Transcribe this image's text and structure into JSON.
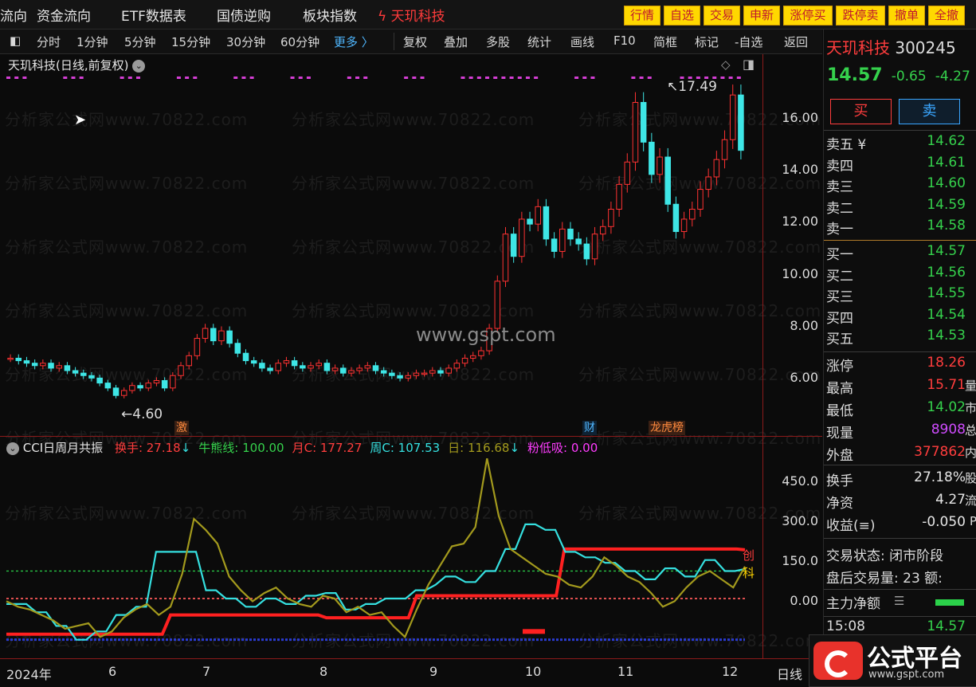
{
  "top_menu": {
    "items": [
      "流向",
      "资金流向",
      "ETF数据表",
      "国债逆购",
      "板块指数"
    ],
    "stock_name": "天玑科技",
    "trade_buttons": [
      "行情",
      "自选",
      "交易",
      "申新",
      "涨停买",
      "跌停卖",
      "撤单",
      "全撤"
    ]
  },
  "toolbar": {
    "periods": [
      "分时",
      "1分钟",
      "5分钟",
      "15分钟",
      "30分钟",
      "60分钟"
    ],
    "more": "更多 〉",
    "actions": [
      "复权",
      "叠加",
      "多股",
      "统计",
      "画线",
      "F10",
      "简框",
      "标记",
      "-自选",
      "返回"
    ]
  },
  "main_chart": {
    "title": "天玑科技(日线,前复权)",
    "high_label": "17.49",
    "low_label": "4.60",
    "tags": [
      {
        "text": "激",
        "color": "#ff8a3d"
      },
      {
        "text": "财",
        "color": "#4fb7ff"
      },
      {
        "text": "龙虎榜",
        "color": "#ff8a3d"
      }
    ],
    "watermark": "分析家公式网www.70822.com",
    "site_watermark": "www.gspt.com"
  },
  "price_axis": [
    "16.00",
    "14.00",
    "12.00",
    "10.00",
    "8.00",
    "6.00"
  ],
  "indicator": {
    "name": "CCI日周月共振",
    "fields": [
      {
        "label": "换手: 27.18",
        "color": "#ff3d3d",
        "arrow": "↓"
      },
      {
        "label": "牛熊线: 100.00",
        "color": "#35d14c",
        "arrow": ""
      },
      {
        "label": "月C: 177.27",
        "color": "#ff3d3d",
        "arrow": ""
      },
      {
        "label": "周C: 107.53",
        "color": "#35e0e0",
        "arrow": ""
      },
      {
        "label": "日: 116.68",
        "color": "#a39a1d",
        "arrow": "↓"
      },
      {
        "label": "粉低吸: 0.00",
        "color": "#ff3cff",
        "arrow": ""
      }
    ],
    "axis": [
      "450.0",
      "300.0",
      "150.0",
      "0.00"
    ],
    "right_labels": {
      "month": "创",
      "day": "科"
    }
  },
  "time_axis": {
    "labels": [
      "2024年",
      "6",
      "7",
      "8",
      "9",
      "10",
      "11",
      "12"
    ],
    "period": "日线"
  },
  "quote": {
    "name": "天玑科技",
    "code": "300245",
    "price": "14.57",
    "change": "-0.65",
    "pct": "-4.27",
    "buy": "买",
    "sell": "卖",
    "asks": [
      {
        "label": "卖五 ¥",
        "price": "14.62"
      },
      {
        "label": "卖四",
        "price": "14.61"
      },
      {
        "label": "卖三",
        "price": "14.60"
      },
      {
        "label": "卖二",
        "price": "14.59"
      },
      {
        "label": "卖一",
        "price": "14.58"
      }
    ],
    "bids": [
      {
        "label": "买一",
        "price": "14.57"
      },
      {
        "label": "买二",
        "price": "14.56"
      },
      {
        "label": "买三",
        "price": "14.55"
      },
      {
        "label": "买四",
        "price": "14.54"
      },
      {
        "label": "买五",
        "price": "14.53"
      }
    ],
    "stats1": [
      {
        "label": "涨停",
        "value": "18.26",
        "color": "#ff3d3d",
        "suffix": ""
      },
      {
        "label": "最高",
        "value": "15.71",
        "color": "#ff3d3d",
        "suffix": "量"
      },
      {
        "label": "最低",
        "value": "14.02",
        "color": "#35d14c",
        "suffix": "市"
      },
      {
        "label": "现量",
        "value": "8908",
        "color": "#d04cff",
        "suffix": "总"
      },
      {
        "label": "外盘",
        "value": "377862",
        "color": "#ff3d3d",
        "suffix": "内"
      }
    ],
    "stats2": [
      {
        "label": "换手",
        "value": "27.18%",
        "suffix": "股"
      },
      {
        "label": "净资",
        "value": "4.27",
        "suffix": "流"
      },
      {
        "label": "收益(≡)",
        "value": "-0.050",
        "suffix": "P"
      }
    ],
    "trade_status": "交易状态: 闭市阶段",
    "after_hours": "盘后交易量: 23  额:",
    "main_net": "主力净额",
    "tick_time": "15:08",
    "tick_price": "14.57"
  },
  "logo": {
    "text": "公式平台",
    "url": "www.gspt.com"
  },
  "chart_data": {
    "type": "candlestick",
    "title": "天玑科技(日线,前复权)",
    "x_labels": [
      "2024年",
      "6",
      "7",
      "8",
      "9",
      "10",
      "11",
      "12"
    ],
    "ylim": [
      4.0,
      17.8
    ],
    "annotations": [
      {
        "text": "17.49"
      },
      {
        "text": "4.60"
      }
    ],
    "close_series": [
      6.2,
      6.1,
      6.0,
      5.9,
      6.0,
      5.8,
      5.9,
      5.7,
      5.6,
      5.5,
      5.4,
      5.2,
      5.0,
      4.7,
      4.9,
      5.1,
      5.0,
      5.2,
      5.3,
      5.0,
      5.5,
      5.9,
      6.3,
      7.0,
      7.4,
      6.9,
      7.3,
      6.8,
      6.4,
      6.1,
      6.0,
      5.8,
      5.7,
      6.0,
      6.1,
      5.9,
      5.8,
      5.9,
      6.0,
      5.7,
      5.8,
      5.6,
      5.7,
      5.8,
      5.9,
      5.7,
      5.6,
      5.5,
      5.4,
      5.5,
      5.6,
      5.6,
      5.7,
      5.6,
      5.8,
      6.0,
      6.2,
      6.3,
      6.5,
      7.4,
      9.3,
      11.2,
      10.3,
      11.8,
      11.6,
      12.3,
      11.0,
      10.5,
      11.4,
      11.0,
      10.8,
      10.2,
      11.2,
      11.5,
      12.2,
      13.2,
      14.1,
      16.5,
      14.9,
      13.6,
      14.3,
      12.4,
      11.3,
      11.8,
      12.2,
      13.0,
      13.5,
      14.2,
      15.0,
      16.8,
      14.57
    ],
    "indicator_series": [
      {
        "name": "月C",
        "color": "#ff2020",
        "values": [
          -130,
          -130,
          -130,
          -130,
          -130,
          -130,
          -130,
          -130,
          -130,
          -130,
          -130,
          -130,
          -130,
          -130,
          -130,
          -130,
          -130,
          -130,
          -130,
          -130,
          -60,
          -60,
          -60,
          -60,
          -60,
          -60,
          -60,
          -60,
          -60,
          -60,
          -60,
          -60,
          -60,
          -60,
          -60,
          -60,
          -60,
          -60,
          -60,
          -70,
          -70,
          -70,
          -70,
          -70,
          -70,
          -70,
          -70,
          -70,
          -70,
          -70,
          10,
          10,
          10,
          10,
          10,
          10,
          10,
          10,
          10,
          10,
          10,
          10,
          10,
          10,
          10,
          10,
          10,
          10,
          180,
          180,
          180,
          180,
          180,
          180,
          180,
          180,
          180,
          180,
          180,
          180,
          180,
          180,
          180,
          180,
          180,
          180,
          180,
          180,
          180,
          180,
          177.27
        ]
      },
      {
        "name": "周C",
        "color": "#35e0e0",
        "values": [
          -20,
          -20,
          -20,
          -50,
          -50,
          -100,
          -100,
          -150,
          -150,
          -120,
          -120,
          -60,
          -60,
          -30,
          -30,
          170,
          170,
          170,
          170,
          170,
          30,
          30,
          0,
          0,
          -30,
          -30,
          0,
          0,
          -20,
          -20,
          10,
          10,
          20,
          20,
          -40,
          -40,
          -20,
          -20,
          0,
          0,
          0,
          30,
          30,
          50,
          80,
          80,
          60,
          60,
          100,
          100,
          180,
          180,
          270,
          270,
          250,
          250,
          170,
          170,
          150,
          150,
          130,
          130,
          100,
          100,
          70,
          70,
          110,
          110,
          80,
          80,
          140,
          140,
          100,
          100,
          107.53
        ]
      },
      {
        "name": "日",
        "color": "#a39a1d",
        "values": [
          -10,
          -30,
          -40,
          -60,
          -80,
          -110,
          -100,
          -90,
          -140,
          -120,
          -70,
          -40,
          -20,
          -60,
          -30,
          90,
          290,
          250,
          200,
          80,
          30,
          -10,
          20,
          40,
          0,
          -20,
          -30,
          10,
          0,
          -50,
          -30,
          -60,
          -50,
          -100,
          -140,
          -40,
          50,
          120,
          190,
          200,
          260,
          510,
          300,
          180,
          150,
          120,
          90,
          80,
          50,
          40,
          80,
          150,
          120,
          80,
          60,
          20,
          -30,
          -10,
          40,
          80,
          100,
          70,
          40,
          116.68
        ]
      }
    ],
    "indicator_ylim": [
      -180,
      560
    ]
  }
}
